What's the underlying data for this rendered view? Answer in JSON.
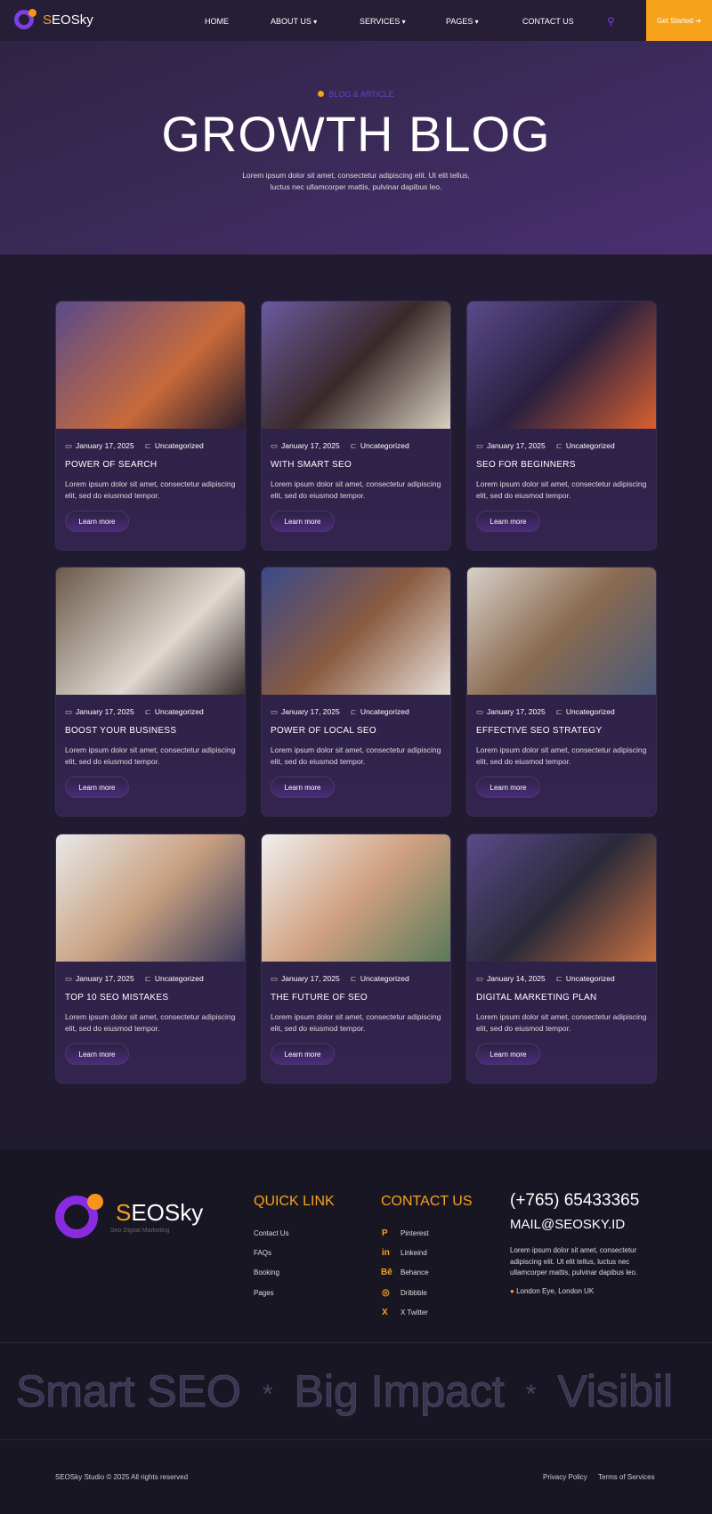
{
  "header": {
    "logo": "SEOSky",
    "logo_first": "S",
    "logo_rest": "EOSky",
    "nav": [
      "HOME",
      "ABOUT US",
      "SERVICES",
      "PAGES",
      "CONTACT US"
    ],
    "cta": "Get Started"
  },
  "hero": {
    "tag": "BLOG & ARTICLE",
    "title": "GROWTH BLOG",
    "subtitle": "Lorem ipsum dolor sit amet, consectetur adipiscing elit. Ut elit tellus, luctus nec ullamcorper mattis, pulvinar dapibus leo."
  },
  "posts": [
    {
      "date": "January 17, 2025",
      "category": "Uncategorized",
      "title": "POWER OF SEARCH",
      "excerpt": "Lorem ipsum dolor sit amet, consectetur adipiscing elit, sed do eiusmod tempor.",
      "button": "Learn more"
    },
    {
      "date": "January 17, 2025",
      "category": "Uncategorized",
      "title": "WITH SMART SEO",
      "excerpt": "Lorem ipsum dolor sit amet, consectetur adipiscing elit, sed do eiusmod tempor.",
      "button": "Learn more"
    },
    {
      "date": "January 17, 2025",
      "category": "Uncategorized",
      "title": "SEO FOR BEGINNERS",
      "excerpt": "Lorem ipsum dolor sit amet, consectetur adipiscing elit, sed do eiusmod tempor.",
      "button": "Learn more"
    },
    {
      "date": "January 17, 2025",
      "category": "Uncategorized",
      "title": "BOOST YOUR BUSINESS",
      "excerpt": "Lorem ipsum dolor sit amet, consectetur adipiscing elit, sed do eiusmod tempor.",
      "button": "Learn more"
    },
    {
      "date": "January 17, 2025",
      "category": "Uncategorized",
      "title": "POWER OF LOCAL SEO",
      "excerpt": "Lorem ipsum dolor sit amet, consectetur adipiscing elit, sed do eiusmod tempor.",
      "button": "Learn more"
    },
    {
      "date": "January 17, 2025",
      "category": "Uncategorized",
      "title": "EFFECTIVE SEO STRATEGY",
      "excerpt": "Lorem ipsum dolor sit amet, consectetur adipiscing elit, sed do eiusmod tempor.",
      "button": "Learn more"
    },
    {
      "date": "January 17, 2025",
      "category": "Uncategorized",
      "title": "TOP 10 SEO MISTAKES",
      "excerpt": "Lorem ipsum dolor sit amet, consectetur adipiscing elit, sed do eiusmod tempor.",
      "button": "Learn more"
    },
    {
      "date": "January 17, 2025",
      "category": "Uncategorized",
      "title": "THE FUTURE OF SEO",
      "excerpt": "Lorem ipsum dolor sit amet, consectetur adipiscing elit, sed do eiusmod tempor.",
      "button": "Learn more"
    },
    {
      "date": "January 14, 2025",
      "category": "Uncategorized",
      "title": "DIGITAL MARKETING PLAN",
      "excerpt": "Lorem ipsum dolor sit amet, consectetur adipiscing elit, sed do eiusmod tempor.",
      "button": "Learn more"
    }
  ],
  "footer": {
    "logo_first": "S",
    "logo_rest": "EOSky",
    "tagline": "Seo Digital Marketing",
    "quick_title": "QUICK LINK",
    "quick_links": [
      "Contact Us",
      "FAQs",
      "Booking",
      "Pages"
    ],
    "contact_title": "CONTACT US",
    "socials": [
      "Pinterest",
      "Linkeind",
      "Behance",
      "Dribbble",
      "X Twitter"
    ],
    "phone": "(+765) 65433365",
    "email": "MAIL@SEOSKY.ID",
    "description": "Lorem ipsum dolor sit amet, consectetur adipiscing elit. Ut elit tellus, luctus nec ullamcorper mattis, pulvinar dapibus leo.",
    "location": "London Eye, London UK",
    "marquee": [
      "Smart SEO",
      "Big Impact",
      "Visibil"
    ],
    "copyright": "SEOSky Studio © 2025 All rights reserved",
    "privacy": "Privacy Policy",
    "terms": "Terms of Services"
  },
  "colors": {
    "accent": "#f7a21b",
    "purple": "#7b3fe4",
    "bg": "#211b31"
  }
}
